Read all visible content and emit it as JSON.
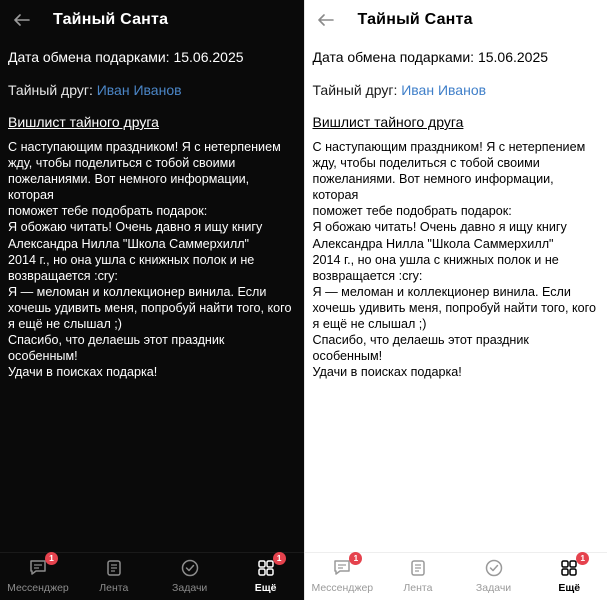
{
  "header": {
    "title": "Тайный Санта"
  },
  "exchange": {
    "label": "Дата обмена подарками:",
    "date": "15.06.2025"
  },
  "friend": {
    "label": "Тайный друг:",
    "name": "Иван Иванов"
  },
  "wishlist": {
    "heading": "Вишлист тайного друга",
    "text": "С наступающим праздником! Я с нетерпением\nжду, чтобы поделиться с тобой своими\nпожеланиями. Вот немного информации, которая\nпоможет тебе подобрать подарок:\nЯ обожаю читать! Очень давно я ищу книгу\nАлександра Нилла \"Школа Саммерхилл\"\n2014 г., но она ушла с книжных полок и не\nвозвращается :cry:\nЯ — меломан и коллекционер винила. Если\nхочешь удивить меня, попробуй найти того, кого\nя ещё не слышал ;)\nСпасибо, что делаешь этот праздник особенным!\nУдачи в поисках подарка!"
  },
  "tabbar": {
    "items": [
      {
        "label": "Мессенджер",
        "icon": "chat-icon",
        "badge": "1"
      },
      {
        "label": "Лента",
        "icon": "feed-icon"
      },
      {
        "label": "Задачи",
        "icon": "tasks-icon"
      },
      {
        "label": "Ещё",
        "icon": "grid-icon",
        "badge": "1",
        "active": true
      }
    ]
  },
  "colors": {
    "accent": "#4b86c7",
    "badge": "#e5424d",
    "dark_bg": "#0a0a0a",
    "light_bg": "#ffffff"
  }
}
